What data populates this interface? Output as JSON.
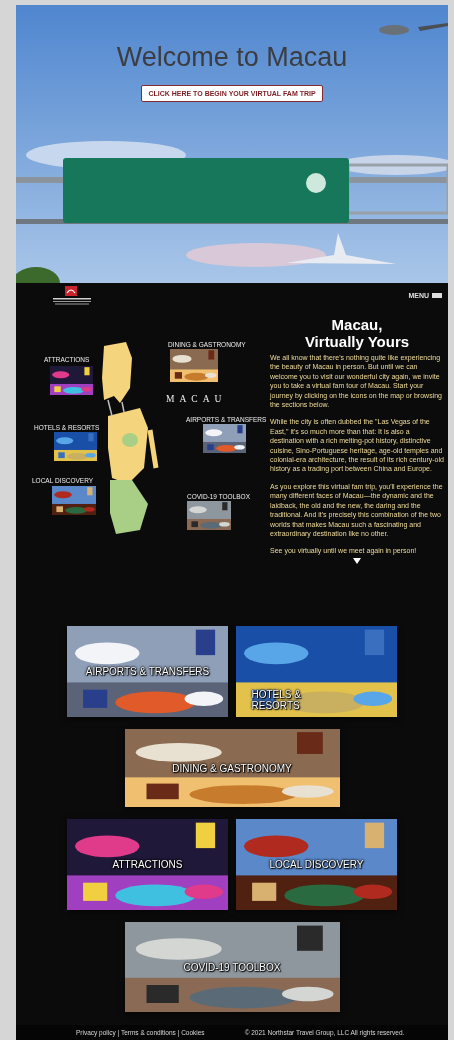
{
  "hero": {
    "title": "Welcome to Macau",
    "button": "CLICK HERE TO BEGIN YOUR VIRTUAL FAM TRIP"
  },
  "nav": {
    "menu": "MENU"
  },
  "map": {
    "label": "MACAU",
    "spots": [
      {
        "label": "ATTRACTIONS"
      },
      {
        "label": "DINING & GASTRONOMY"
      },
      {
        "label": "AIRPORTS & TRANSFERS"
      },
      {
        "label": "HOTELS & RESORTS"
      },
      {
        "label": "LOCAL DISCOVERY"
      },
      {
        "label": "COVID-19 TOOLBOX"
      }
    ]
  },
  "intro": {
    "title": [
      "Macau,",
      "Virtually Yours"
    ],
    "paragraphs": [
      "We all know that there's nothing quite like experiencing the beauty of Macau in person. But until we can welcome you to visit our wonderful city again, we invite you to take a virtual fam tour of Macau. Start your journey by clicking on the icons on the map or browsing the sections below.",
      "While the city is often dubbed the \"Las Vegas of the East,\" it's so much more than that: It is also a destination with a rich melting-pot history, distinctive cuisine, Sino-Portuguese heritage, age-old temples and colonial-era architecture, the result of its rich century-old history as a trading port between China and Europe.",
      "As you explore this virtual fam trip, you'll experience the many different faces of Macau—the dynamic and the laidback, the old and the new, the daring and the traditional. And it's precisely this combination of the two worlds that makes Macau such a fascinating and extraordinary destination like no other.",
      "See you virtually until we meet again in person!"
    ]
  },
  "sections": [
    {
      "label": "AIRPORTS & TRANSFERS"
    },
    {
      "label": "HOTELS & RESORTS"
    },
    {
      "label": "DINING & GASTRONOMY"
    },
    {
      "label": "ATTRACTIONS"
    },
    {
      "label": "LOCAL DISCOVERY"
    },
    {
      "label": "COVID-19 TOOLBOX"
    }
  ],
  "footer": {
    "links": "Privacy policy | Terms & conditions | Cookies",
    "copyright": "© 2021 Northstar Travel Group, LLC All rights reserved."
  }
}
